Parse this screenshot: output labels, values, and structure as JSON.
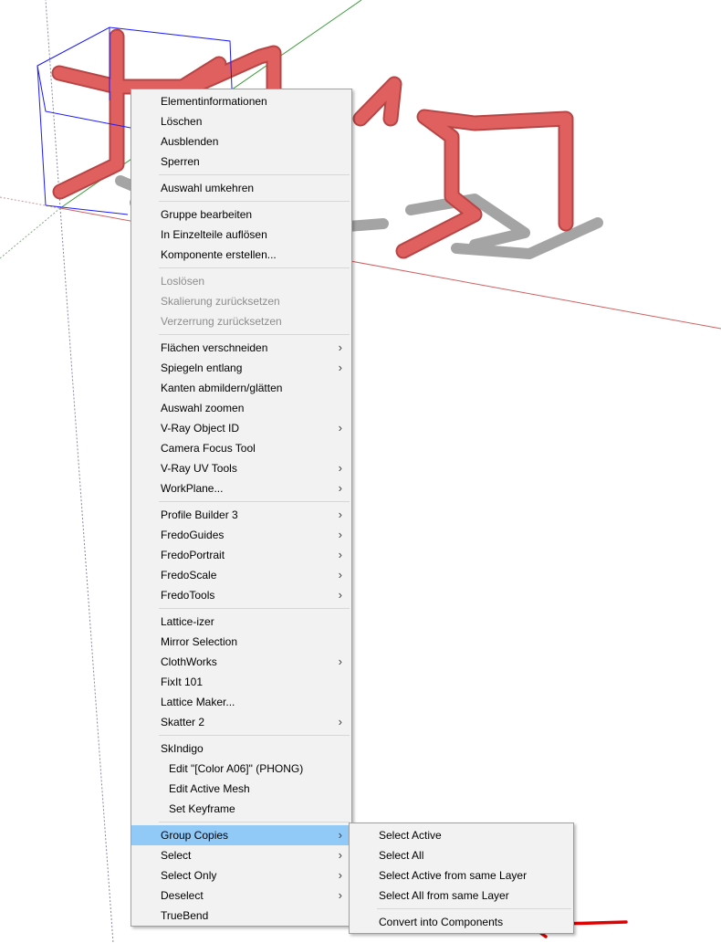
{
  "main_menu": [
    {
      "label": "Elementinformationen"
    },
    {
      "label": "Löschen"
    },
    {
      "label": "Ausblenden"
    },
    {
      "label": "Sperren"
    },
    {
      "sep": true
    },
    {
      "label": "Auswahl umkehren"
    },
    {
      "sep": true
    },
    {
      "label": "Gruppe bearbeiten"
    },
    {
      "label": "In Einzelteile auflösen"
    },
    {
      "label": "Komponente erstellen..."
    },
    {
      "sep": true
    },
    {
      "label": "Loslösen",
      "disabled": true
    },
    {
      "label": "Skalierung zurücksetzen",
      "disabled": true
    },
    {
      "label": "Verzerrung zurücksetzen",
      "disabled": true
    },
    {
      "sep": true
    },
    {
      "label": "Flächen verschneiden",
      "submenu": true
    },
    {
      "label": "Spiegeln entlang",
      "submenu": true
    },
    {
      "label": "Kanten abmildern/glätten"
    },
    {
      "label": "Auswahl zoomen"
    },
    {
      "label": "V-Ray Object ID",
      "submenu": true
    },
    {
      "label": "Camera Focus Tool"
    },
    {
      "label": "V-Ray UV Tools",
      "submenu": true
    },
    {
      "label": "WorkPlane...",
      "submenu": true
    },
    {
      "sep": true
    },
    {
      "label": "Profile Builder 3",
      "submenu": true
    },
    {
      "label": "FredoGuides",
      "submenu": true
    },
    {
      "label": "FredoPortrait",
      "submenu": true
    },
    {
      "label": "FredoScale",
      "submenu": true
    },
    {
      "label": "FredoTools",
      "submenu": true
    },
    {
      "sep": true
    },
    {
      "label": "Lattice-izer"
    },
    {
      "label": "Mirror Selection"
    },
    {
      "label": "ClothWorks",
      "submenu": true
    },
    {
      "label": "FixIt 101"
    },
    {
      "label": "Lattice Maker..."
    },
    {
      "label": "Skatter 2",
      "submenu": true
    },
    {
      "sep": true
    },
    {
      "label": "SkIndigo"
    },
    {
      "label": "Edit \"[Color A06]\" (PHONG)",
      "indent": true
    },
    {
      "label": "Edit Active Mesh",
      "indent": true
    },
    {
      "label": "Set Keyframe",
      "indent": true
    },
    {
      "sep": true
    },
    {
      "label": "Group Copies",
      "submenu": true,
      "active": true
    },
    {
      "label": "Select",
      "submenu": true
    },
    {
      "label": "Select Only",
      "submenu": true
    },
    {
      "label": "Deselect",
      "submenu": true
    },
    {
      "label": "TrueBend"
    }
  ],
  "sub_menu": [
    {
      "label": "Select Active"
    },
    {
      "label": "Select All"
    },
    {
      "label": "Select Active from same Layer"
    },
    {
      "label": "Select All from same Layer"
    },
    {
      "sep": true
    },
    {
      "label": "Convert into Components"
    }
  ],
  "submenu_arrow": "›",
  "colors": {
    "tube": "#e06060",
    "tube_dark": "#b84545",
    "selection": "#1a1aff",
    "highlight": "#91c9f7",
    "arrow": "#e00000",
    "axis_red": "#d06060",
    "axis_green": "#3a9a3a",
    "shadow": "#a0a0a0"
  }
}
